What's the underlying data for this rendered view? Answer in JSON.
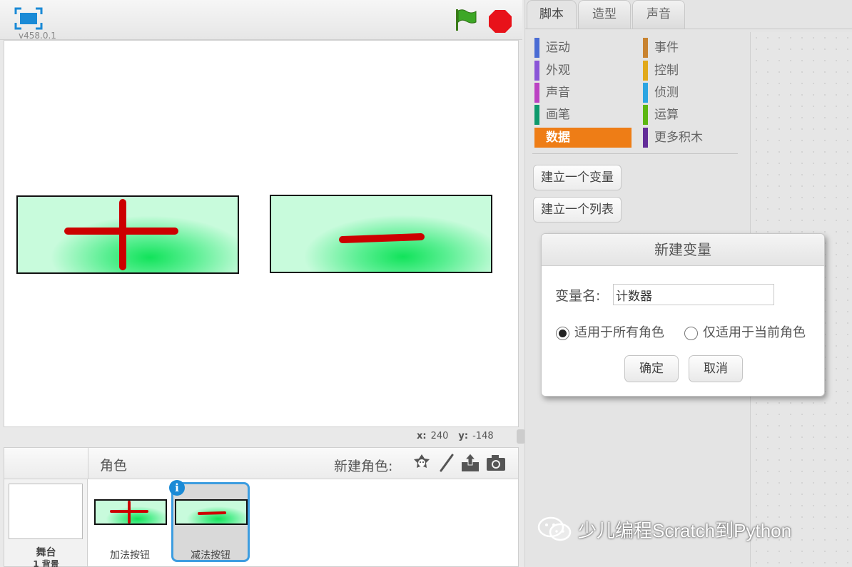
{
  "stage": {
    "version": "v458.0.1",
    "coords": {
      "x_label": "x:",
      "x_value": "240",
      "y_label": "y:",
      "y_value": "-148"
    }
  },
  "sprite_pane": {
    "title": "角色",
    "new_sprite_label": "新建角色:",
    "new_sprite_icons": [
      "sprite-library-icon",
      "paint-brush-icon",
      "upload-icon",
      "camera-icon"
    ],
    "stage_label": "舞台",
    "backdrop_count": "1 背景",
    "sprites": [
      {
        "name": "加法按钮",
        "selected": false
      },
      {
        "name": "减法按钮",
        "selected": true
      }
    ],
    "info_icon": "i"
  },
  "tabs": [
    {
      "label": "脚本",
      "active": true
    },
    {
      "label": "造型",
      "active": false
    },
    {
      "label": "声音",
      "active": false
    }
  ],
  "categories": {
    "left": [
      {
        "label": "运动",
        "color": "#4a6cd4"
      },
      {
        "label": "外观",
        "color": "#8a55d7"
      },
      {
        "label": "声音",
        "color": "#bb42c3"
      },
      {
        "label": "画笔",
        "color": "#0e9a6c"
      },
      {
        "label": "数据",
        "color": "#ee7d16",
        "active": true
      }
    ],
    "right": [
      {
        "label": "事件",
        "color": "#c88330"
      },
      {
        "label": "控制",
        "color": "#e1a91a"
      },
      {
        "label": "侦测",
        "color": "#2ca5e2"
      },
      {
        "label": "运算",
        "color": "#5cb712"
      },
      {
        "label": "更多积木",
        "color": "#632d99"
      }
    ]
  },
  "palette_buttons": {
    "make_variable": "建立一个变量",
    "make_list": "建立一个列表"
  },
  "dialog": {
    "title": "新建变量",
    "var_name_label": "变量名:",
    "var_name_value": "计数器",
    "option_all": "适用于所有角色",
    "option_this": "仅适用于当前角色",
    "selected_option": "all",
    "ok": "确定",
    "cancel": "取消"
  },
  "watermark": {
    "text": "少儿编程Scratch到Python",
    "icon": "wechat-icon"
  }
}
